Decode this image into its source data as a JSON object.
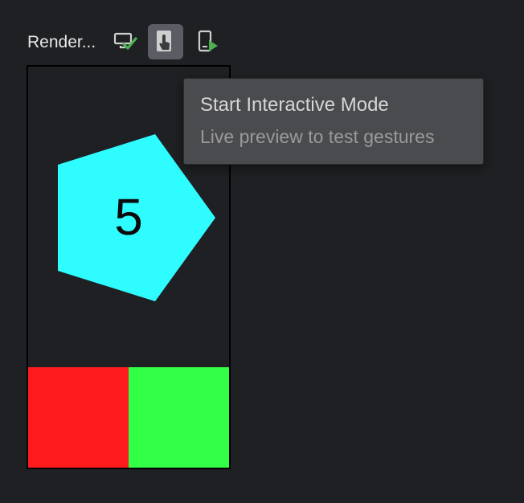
{
  "toolbar": {
    "preview_label": "Render...",
    "buttons": [
      {
        "name": "validate-render-button",
        "icon": "device-check-icon",
        "check_color": "#4caf50"
      },
      {
        "name": "start-interactive-mode-button",
        "icon": "touch-gesture-icon",
        "active": true
      },
      {
        "name": "deploy-preview-button",
        "icon": "device-run-icon",
        "run_color": "#4caf50"
      }
    ]
  },
  "tooltip": {
    "title": "Start Interactive Mode",
    "subtitle": "Live preview to test gestures"
  },
  "preview": {
    "pentagon_label": "5",
    "colors": {
      "pentagon": "#2ffcff",
      "red": "#ff1b1b",
      "green": "#33ff46",
      "background": "#1f2023"
    }
  }
}
